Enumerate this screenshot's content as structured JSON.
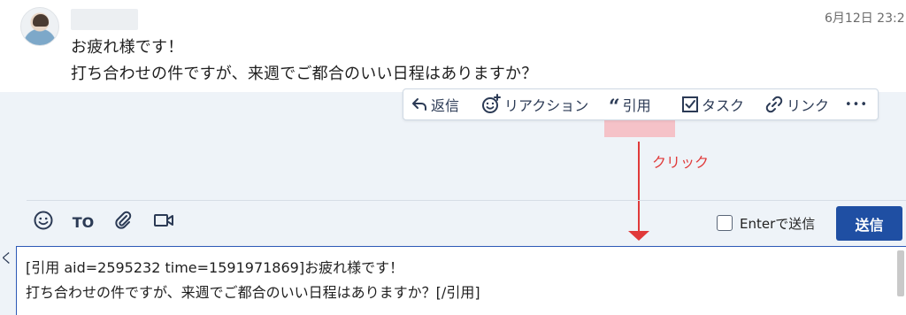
{
  "message": {
    "timestamp": "6月12日 23:2",
    "lines": [
      "お疲れ様です！",
      "打ち合わせの件ですが、来週でご都合のいい日程はありますか？"
    ]
  },
  "action_bar": {
    "reply": "返信",
    "reaction": "リアクション",
    "quote": "引用",
    "task": "タスク",
    "link": "リンク",
    "more": "•••"
  },
  "annotation": {
    "click_label": "クリック",
    "color": "#e03a3a",
    "highlight_color": "#f6b9bf"
  },
  "composer": {
    "to_label": "TO",
    "enter_to_send_label": "Enterで送信",
    "enter_to_send_checked": false,
    "send_label": "送信",
    "left_tab_char": "く",
    "text_lines": [
      "[引用 aid=2595232 time=1591971869]お疲れ様です！",
      "打ち合わせの件ですが、来週でご都合のいい日程はありますか？[/引用]"
    ]
  },
  "colors": {
    "accent": "#1f4fa3",
    "icon": "#2b3a55",
    "panel_bg": "#eef3f8"
  },
  "icons": [
    "reply-icon",
    "reaction-icon",
    "quote-icon",
    "task-icon",
    "link-icon",
    "emoji-icon",
    "attach-icon",
    "video-icon"
  ]
}
